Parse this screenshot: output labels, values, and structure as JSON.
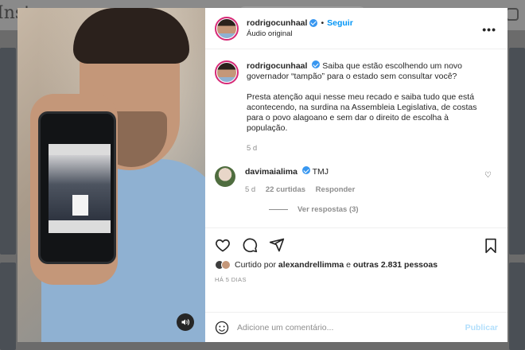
{
  "background": {
    "logo_text": "Instag"
  },
  "post": {
    "author": {
      "username": "rodrigocunhaal",
      "verified": true,
      "follow_label": "Seguir",
      "audio_label": "Áudio original"
    },
    "more_icon": "more-horizontal-icon",
    "caption": {
      "paragraph1": "Saiba que estão escolhendo um novo governador “tampão” para o estado sem consultar você?",
      "paragraph2": "Presta atenção aqui nesse meu recado e saiba tudo que está acontecendo, na surdina na Assembleia Legislativa, de costas para o povo alagoano e sem dar o direito de escolha à população.",
      "time": "5 d"
    },
    "comments": [
      {
        "username": "davimaialima",
        "verified": true,
        "text": "TMJ",
        "time": "5 d",
        "likes": "22 curtidas",
        "reply_label": "Responder",
        "view_replies": "Ver respostas (3)"
      }
    ],
    "likes_text_prefix": "Curtido por",
    "likes_user": "alexandrellimma",
    "likes_text_mid": "e",
    "likes_others": "outras 2.831 pessoas",
    "posted_ago": "HÁ 5 DIAS",
    "add_comment": {
      "placeholder": "Adicione um comentário...",
      "publish_label": "Publicar"
    },
    "colors": {
      "accent": "#0095f6",
      "verified": "#3897f0",
      "publish_disabled": "#b2dffc"
    }
  }
}
